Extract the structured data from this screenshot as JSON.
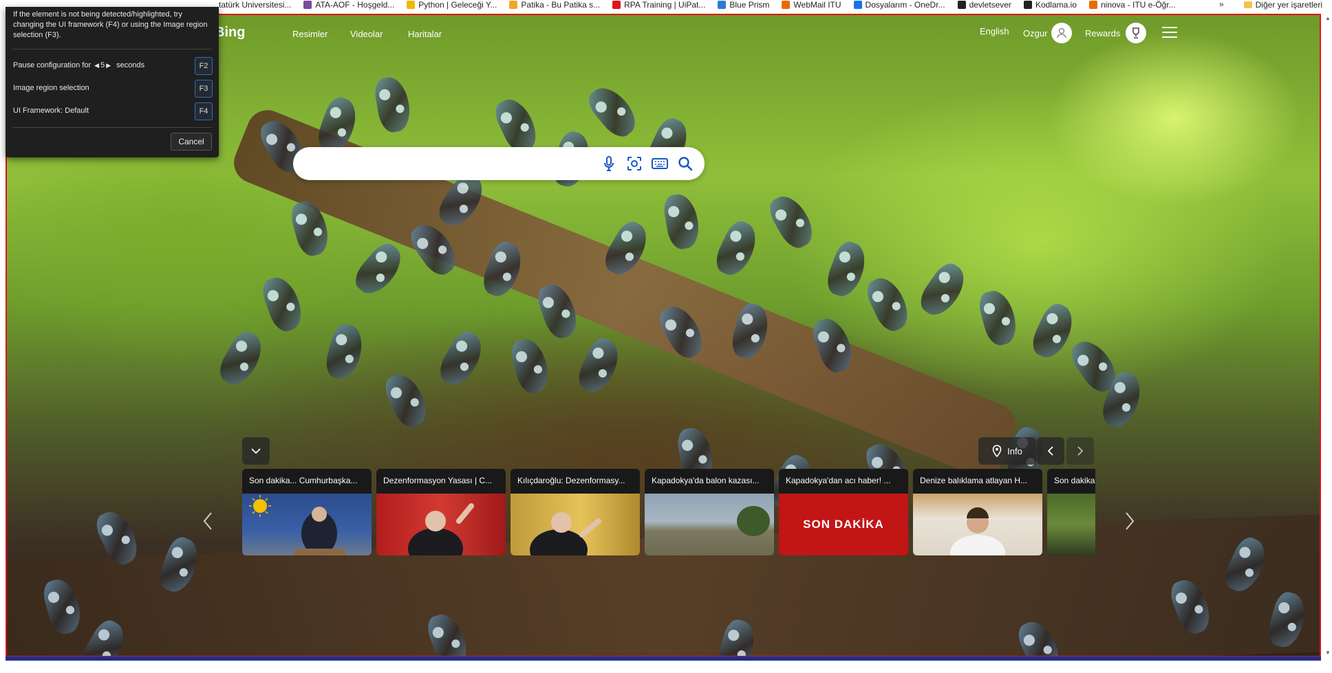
{
  "bookmarks": {
    "items": [
      {
        "label": "tatürk Universitesi...",
        "color": "#ffffff"
      },
      {
        "label": "ATA-AOF - Hoşgeld...",
        "color": "#7b4aa0"
      },
      {
        "label": "Python | Geleceği Y...",
        "color": "#f2b705"
      },
      {
        "label": "Patika - Bu Patika s...",
        "color": "#f5a623"
      },
      {
        "label": "RPA Training | UiPat...",
        "color": "#e0141b"
      },
      {
        "label": "Blue Prism",
        "color": "#2a7bd8"
      },
      {
        "label": "WebMail ITU",
        "color": "#e96a00"
      },
      {
        "label": "Dosyalarım - OneDr...",
        "color": "#1a73e8"
      },
      {
        "label": "devletsever",
        "color": "#222222"
      },
      {
        "label": "Kodlama.io",
        "color": "#222222"
      },
      {
        "label": "ninova - ITU e-Öğr...",
        "color": "#e96a00"
      }
    ],
    "more": "»",
    "other": "Diğer yer işaretleri"
  },
  "bing": {
    "logo": "Bing",
    "nav": [
      "Resimler",
      "Videolar",
      "Haritalar"
    ],
    "language": "English",
    "user": "Ozgur",
    "rewards": "Rewards",
    "search_value": ""
  },
  "dialog": {
    "message": "If the element is not being detected/highlighted, try changing the UI framework (F4) or using the Image region selection (F3).",
    "pause_prefix": "Pause configuration for",
    "pause_value": "5",
    "pause_suffix": "seconds",
    "pause_key": "F2",
    "image_region_label": "Image region selection",
    "image_region_key": "F3",
    "framework_label": "UI Framework: Default",
    "framework_key": "F4",
    "cancel": "Cancel"
  },
  "carousel": {
    "info": "Info",
    "cards": [
      {
        "title": "Son dakika... Cumhurbaşka..."
      },
      {
        "title": "Dezenformasyon Yasası | C..."
      },
      {
        "title": "Kılıçdaroğlu: Dezenformasy..."
      },
      {
        "title": "Kapadokya'da balon kazası..."
      },
      {
        "title": "Kapadokya'dan acı haber! ..."
      },
      {
        "title": "Denize balıklama atlayan H..."
      },
      {
        "title": "Son dakika"
      }
    ],
    "banner_text": "SON DAKİKA"
  },
  "colors": {
    "frame": "#e0141b",
    "dialog_bg": "#1f1f1f",
    "key_border": "#2f6fb5"
  }
}
